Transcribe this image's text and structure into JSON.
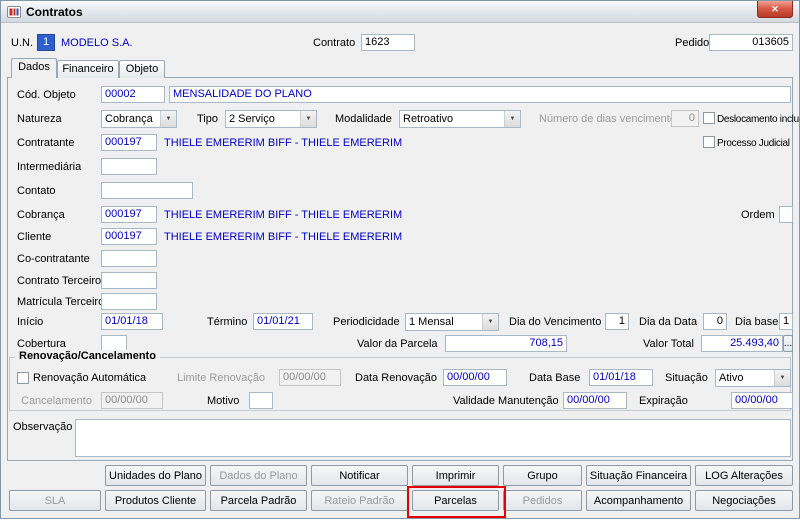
{
  "window": {
    "title": "Contratos",
    "close_glyph": "✕"
  },
  "header": {
    "un_label": "U.N.",
    "un_value": "1",
    "un_name": "MODELO S.A.",
    "contrato_label": "Contrato",
    "contrato_value": "1623",
    "pedido_label": "Pedido",
    "pedido_value": "013605"
  },
  "tabs": {
    "dados": "Dados",
    "financeiro": "Financeiro",
    "objeto": "Objeto"
  },
  "main": {
    "cod_objeto": {
      "label": "Cód. Objeto",
      "code": "00002",
      "desc": "MENSALIDADE DO PLANO"
    },
    "natureza": {
      "label": "Natureza",
      "value": "Cobrança"
    },
    "tipo": {
      "label": "Tipo",
      "value": "2 Serviço"
    },
    "modalidade": {
      "label": "Modalidade",
      "value": "Retroativo"
    },
    "dias_vencimento": {
      "label": "Número de dias vencimento",
      "value": "0"
    },
    "deslocamento": {
      "label": "Deslocamento incluso",
      "checked": false
    },
    "processo_judicial": {
      "label": "Processo Judicial",
      "checked": false
    },
    "contratante": {
      "label": "Contratante",
      "code": "000197",
      "name": "THIELE EMERERIM BIFF - THIELE EMERERIM"
    },
    "intermediaria": {
      "label": "Intermediária",
      "value": ""
    },
    "contato": {
      "label": "Contato",
      "value": ""
    },
    "cobranca": {
      "label": "Cobrança",
      "code": "000197",
      "name": "THIELE EMERERIM BIFF - THIELE EMERERIM"
    },
    "ordem": {
      "label": "Ordem",
      "value": ""
    },
    "cliente": {
      "label": "Cliente",
      "code": "000197",
      "name": "THIELE EMERERIM BIFF - THIELE EMERERIM"
    },
    "co_contratante": {
      "label": "Co-contratante",
      "value": ""
    },
    "contrato_terceiro": {
      "label": "Contrato Terceiro",
      "value": ""
    },
    "matricula_terceiro": {
      "label": "Matrícula Terceiro",
      "value": ""
    },
    "inicio": {
      "label": "Início",
      "value": "01/01/18"
    },
    "termino": {
      "label": "Término",
      "value": "01/01/21"
    },
    "periodicidade": {
      "label": "Periodicidade",
      "value": "1 Mensal"
    },
    "dia_vencimento": {
      "label": "Dia do Vencimento",
      "value": "1"
    },
    "dia_data": {
      "label": "Dia da Data",
      "value": "0"
    },
    "dia_base": {
      "label": "Dia base",
      "value": "1"
    },
    "cobertura": {
      "label": "Cobertura",
      "value": ""
    },
    "valor_parcela": {
      "label": "Valor da Parcela",
      "value": "708,15"
    },
    "valor_total": {
      "label": "Valor Total",
      "value": "25.493,40",
      "more": "..."
    }
  },
  "renovacao": {
    "title": "Renovação/Cancelamento",
    "auto_label": "Renovação Automática",
    "auto_checked": false,
    "limite": {
      "label": "Limite Renovação",
      "value": "00/00/00"
    },
    "data_renovacao": {
      "label": "Data Renovação",
      "value": "00/00/00"
    },
    "data_base": {
      "label": "Data Base",
      "value": "01/01/18"
    },
    "situacao": {
      "label": "Situação",
      "value": "Ativo"
    },
    "cancelamento": {
      "label": "Cancelamento",
      "value": "00/00/00"
    },
    "motivo": {
      "label": "Motivo",
      "value": ""
    },
    "validade": {
      "label": "Validade Manutenção",
      "value": "00/00/00"
    },
    "expiracao": {
      "label": "Expiração",
      "value": "00/00/00"
    }
  },
  "observacao": {
    "label": "Observação",
    "value": ""
  },
  "footer": {
    "row1": [
      "Unidades do Plano",
      "Dados do Plano",
      "Notificar",
      "Imprimir",
      "Grupo",
      "Situação Financeira",
      "LOG Alterações"
    ],
    "row1_disabled": [
      false,
      true,
      false,
      false,
      false,
      false,
      false
    ],
    "row2": [
      "SLA",
      "Produtos Cliente",
      "Parcela Padrão",
      "Rateio Padrão",
      "Parcelas",
      "Pedidos",
      "Acompanhamento",
      "Negociações"
    ],
    "row2_disabled": [
      true,
      false,
      false,
      true,
      false,
      true,
      false,
      false
    ],
    "highlight_color": "#e40000"
  },
  "colors": {
    "value_text": "#0000c0",
    "window_bg": "#f0f0f0"
  }
}
